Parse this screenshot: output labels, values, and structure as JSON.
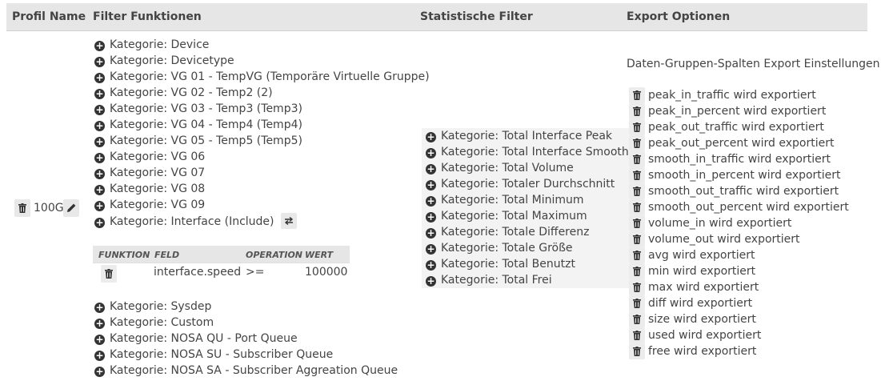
{
  "header": {
    "profile_name": "Profil Name",
    "filter_funktionen": "Filter Funktionen",
    "statistische_filter": "Statistische Filter",
    "export_optionen": "Export Optionen"
  },
  "profile": {
    "name": "100G"
  },
  "filters_top": [
    "Kategorie: Device",
    "Kategorie: Devicetype",
    "Kategorie: VG 01 - TempVG (Temporäre Virtuelle Gruppe)",
    "Kategorie: VG 02 - Temp2 (2)",
    "Kategorie: VG 03 - Temp3 (Temp3)",
    "Kategorie: VG 04 - Temp4 (Temp4)",
    "Kategorie: VG 05 - Temp5 (Temp5)",
    "Kategorie: VG 06",
    "Kategorie: VG 07",
    "Kategorie: VG 08",
    "Kategorie: VG 09",
    "Kategorie: Interface (Include)"
  ],
  "condition_table": {
    "headers": [
      "FUNKTION",
      "FELD",
      "OPERATION",
      "WERT"
    ],
    "row": {
      "feld": "interface.speed",
      "operation": ">=",
      "wert": "100000"
    }
  },
  "filters_bottom": [
    "Kategorie: Sysdep",
    "Kategorie: Custom",
    "Kategorie: NOSA QU - Port Queue",
    "Kategorie: NOSA SU - Subscriber Queue",
    "Kategorie: NOSA SA - Subscriber Aggreation Queue"
  ],
  "stat_filters": [
    "Kategorie: Total Interface Peak",
    "Kategorie: Total Interface Smooth",
    "Kategorie: Total Volume",
    "Kategorie: Totaler Durchschnitt",
    "Kategorie: Total Minimum",
    "Kategorie: Total Maximum",
    "Kategorie: Totale Differenz",
    "Kategorie: Totale Größe",
    "Kategorie: Total Benutzt",
    "Kategorie: Total Frei"
  ],
  "export": {
    "heading": "Daten-Gruppen-Spalten Export Einstellungen",
    "items": [
      "peak_in_traffic wird exportiert",
      "peak_in_percent wird exportiert",
      "peak_out_traffic wird exportiert",
      "peak_out_percent wird exportiert",
      "smooth_in_traffic wird exportiert",
      "smooth_in_percent wird exportiert",
      "smooth_out_traffic wird exportiert",
      "smooth_out_percent wird exportiert",
      "volume_in wird exportiert",
      "volume_out wird exportiert",
      "avg wird exportiert",
      "min wird exportiert",
      "max wird exportiert",
      "diff wird exportiert",
      "size wird exportiert",
      "used wird exportiert",
      "free wird exportiert"
    ]
  },
  "icons": {
    "delete": "trash-icon",
    "edit": "pencil-icon",
    "add": "plus-circle-icon",
    "swap": "swap-icon"
  }
}
